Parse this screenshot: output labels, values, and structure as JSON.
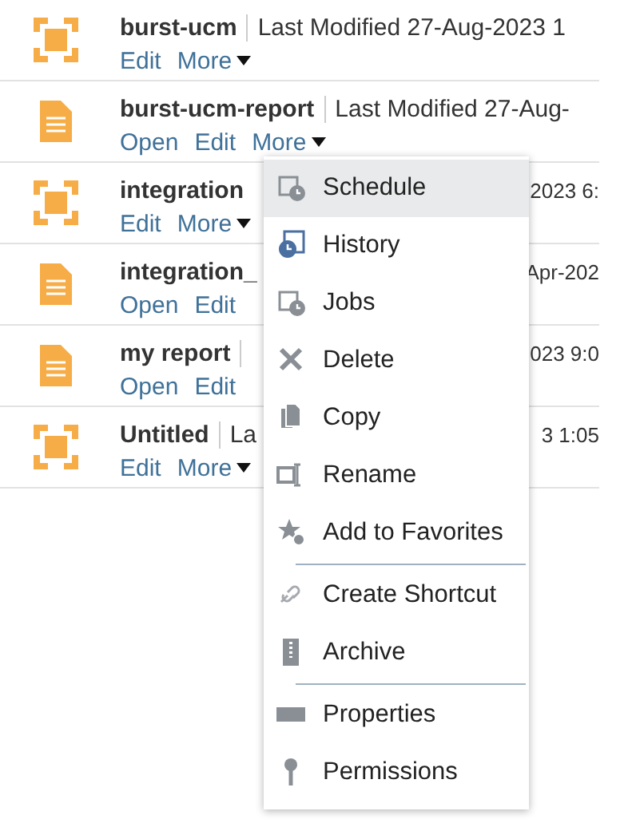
{
  "rows": [
    {
      "kind": "layout",
      "title": "burst-ucm",
      "meta": "Last Modified 27-Aug-2023 1",
      "links": [
        {
          "label": "Edit",
          "dropdown": false
        },
        {
          "label": "More",
          "dropdown": true
        }
      ]
    },
    {
      "kind": "report",
      "title": "burst-ucm-report",
      "meta": "Last Modified 27-Aug-",
      "links": [
        {
          "label": "Open",
          "dropdown": false
        },
        {
          "label": "Edit",
          "dropdown": false
        },
        {
          "label": "More",
          "dropdown": true
        }
      ]
    },
    {
      "kind": "layout",
      "title": "integration",
      "tail": "2023 6:",
      "links": [
        {
          "label": "Edit",
          "dropdown": false
        },
        {
          "label": "More",
          "dropdown": true
        }
      ]
    },
    {
      "kind": "report",
      "title": "integration_",
      "tail": "Apr-202",
      "links": [
        {
          "label": "Open",
          "dropdown": false
        },
        {
          "label": "Edit",
          "dropdown": false
        }
      ]
    },
    {
      "kind": "report",
      "title": "my report",
      "meta": "",
      "tail": "023 9:0",
      "links": [
        {
          "label": "Open",
          "dropdown": false
        },
        {
          "label": "Edit",
          "dropdown": false
        }
      ]
    },
    {
      "kind": "layout",
      "title": "Untitled",
      "meta": "La",
      "tail": "3 1:05",
      "links": [
        {
          "label": "Edit",
          "dropdown": false
        },
        {
          "label": "More",
          "dropdown": true
        }
      ]
    }
  ],
  "menu": {
    "items": [
      {
        "label": "Schedule",
        "selected": true
      },
      {
        "label": "History",
        "selected": false
      },
      {
        "label": "Jobs",
        "selected": false
      },
      {
        "label": "Delete",
        "selected": false
      },
      {
        "label": "Copy",
        "selected": false
      },
      {
        "label": "Rename",
        "selected": false
      },
      {
        "label": "Add to Favorites",
        "selected": false,
        "divider_after": true
      },
      {
        "label": "Create Shortcut",
        "selected": false
      },
      {
        "label": "Archive",
        "selected": false,
        "divider_after": true
      },
      {
        "label": "Properties",
        "selected": false
      },
      {
        "label": "Permissions",
        "selected": false
      }
    ]
  }
}
